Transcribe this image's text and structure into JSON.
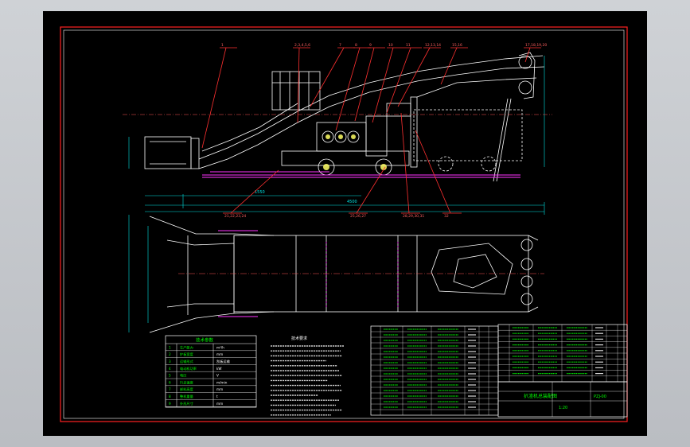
{
  "drawing": {
    "view": "CAD drawing viewport",
    "colors": {
      "background": "#000000",
      "outline": "#ffffff",
      "frame": "#ff2222",
      "dimension": "#00e5e5",
      "hatch": "#ff33ff",
      "table_text": "#00ff00",
      "table_value": "#ffffff",
      "leader": "#ff3030",
      "fill": "#ffff66"
    },
    "balloons_top": [
      "1",
      "2,3,4,5,6",
      "7",
      "8",
      "9",
      "10",
      "11",
      "12,13,14",
      "15,16",
      "17,18,19,20"
    ],
    "balloons_mid": [
      "21,22,23,24",
      "25,26,27",
      "28,29,30,31",
      "32"
    ],
    "dimensions": [
      "1550",
      "4500"
    ],
    "tech_title": "技术要求",
    "spec_title": "技术参数",
    "spec_rows": [
      {
        "no": "1",
        "label": "生产能力",
        "value": "m³/h"
      },
      {
        "no": "2",
        "label": "铲板宽度",
        "value": "mm"
      },
      {
        "no": "3",
        "label": "运输形式",
        "value": "刮板运输"
      },
      {
        "no": "4",
        "label": "电动机功率",
        "value": "kW"
      },
      {
        "no": "5",
        "label": "电压",
        "value": "V"
      },
      {
        "no": "6",
        "label": "行走速度",
        "value": "m/min"
      },
      {
        "no": "7",
        "label": "卸料高度",
        "value": "mm"
      },
      {
        "no": "8",
        "label": "整机重量",
        "value": "t"
      },
      {
        "no": "9",
        "label": "外形尺寸",
        "value": "mm"
      }
    ],
    "title_block": {
      "name": "扒渣机总装配图",
      "code": "PZJ-00",
      "scale": "1:20"
    }
  }
}
